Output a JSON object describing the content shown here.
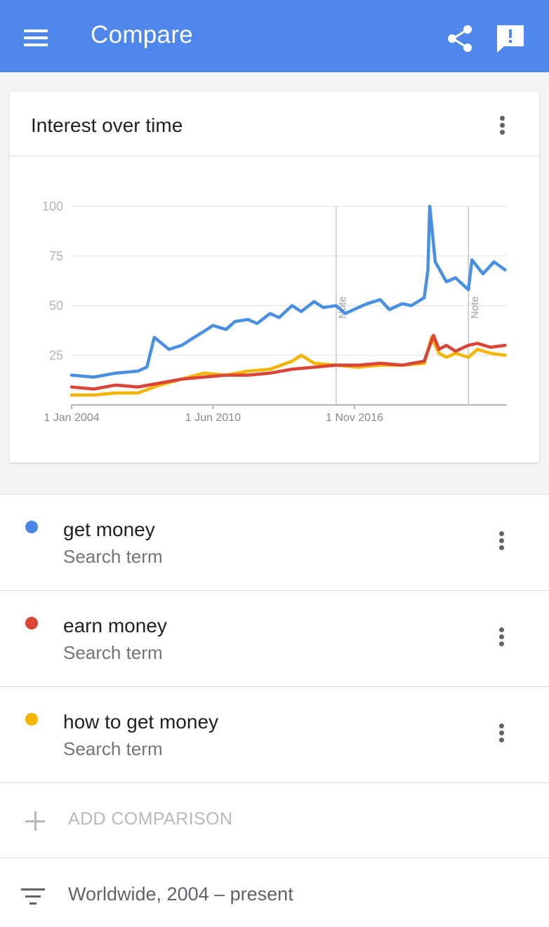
{
  "appbar": {
    "title": "Compare"
  },
  "card": {
    "title": "Interest over time"
  },
  "chart_data": {
    "type": "line",
    "y_ticks": [
      "100",
      "75",
      "50",
      "25"
    ],
    "ylim": [
      0,
      100
    ],
    "x_ticks": [
      "1 Jan 2004",
      "1 Jun 2010",
      "1 Nov 2016"
    ],
    "x_tick_dates": [
      "2004-01-01",
      "2010-06-01",
      "2016-11-01"
    ],
    "x_range": [
      "2004-01-01",
      "2023-10-01"
    ],
    "notes": [
      {
        "date": "2016-01-01",
        "label": "Note"
      },
      {
        "date": "2022-01-01",
        "label": "Note"
      }
    ],
    "grid": true,
    "series": [
      {
        "name": "get money",
        "color": "#4a90e2",
        "points": [
          [
            "2004-01-01",
            15
          ],
          [
            "2005-01-01",
            14
          ],
          [
            "2006-01-01",
            16
          ],
          [
            "2007-01-01",
            17
          ],
          [
            "2007-06-01",
            19
          ],
          [
            "2007-10-01",
            34
          ],
          [
            "2008-06-01",
            28
          ],
          [
            "2009-01-01",
            30
          ],
          [
            "2009-06-01",
            33
          ],
          [
            "2010-01-01",
            37
          ],
          [
            "2010-06-01",
            40
          ],
          [
            "2011-01-01",
            38
          ],
          [
            "2011-06-01",
            42
          ],
          [
            "2012-01-01",
            43
          ],
          [
            "2012-06-01",
            41
          ],
          [
            "2013-01-01",
            46
          ],
          [
            "2013-06-01",
            44
          ],
          [
            "2014-01-01",
            50
          ],
          [
            "2014-06-01",
            47
          ],
          [
            "2015-01-01",
            52
          ],
          [
            "2015-06-01",
            49
          ],
          [
            "2016-01-01",
            50
          ],
          [
            "2016-06-01",
            46
          ],
          [
            "2017-01-01",
            49
          ],
          [
            "2017-06-01",
            51
          ],
          [
            "2018-01-01",
            53
          ],
          [
            "2018-06-01",
            48
          ],
          [
            "2019-01-01",
            51
          ],
          [
            "2019-06-01",
            50
          ],
          [
            "2020-01-01",
            54
          ],
          [
            "2020-03-01",
            68
          ],
          [
            "2020-04-01",
            100
          ],
          [
            "2020-07-01",
            72
          ],
          [
            "2021-01-01",
            62
          ],
          [
            "2021-06-01",
            64
          ],
          [
            "2022-01-01",
            58
          ],
          [
            "2022-03-01",
            73
          ],
          [
            "2022-09-01",
            66
          ],
          [
            "2023-03-01",
            72
          ],
          [
            "2023-09-01",
            68
          ]
        ]
      },
      {
        "name": "earn money",
        "color": "#db4437",
        "points": [
          [
            "2004-01-01",
            9
          ],
          [
            "2005-01-01",
            8
          ],
          [
            "2006-01-01",
            10
          ],
          [
            "2007-01-01",
            9
          ],
          [
            "2008-01-01",
            11
          ],
          [
            "2009-01-01",
            13
          ],
          [
            "2010-01-01",
            14
          ],
          [
            "2011-01-01",
            15
          ],
          [
            "2012-01-01",
            15
          ],
          [
            "2013-01-01",
            16
          ],
          [
            "2014-01-01",
            18
          ],
          [
            "2015-01-01",
            19
          ],
          [
            "2016-01-01",
            20
          ],
          [
            "2017-01-01",
            20
          ],
          [
            "2018-01-01",
            21
          ],
          [
            "2019-01-01",
            20
          ],
          [
            "2020-01-01",
            22
          ],
          [
            "2020-06-01",
            35
          ],
          [
            "2020-09-01",
            28
          ],
          [
            "2021-01-01",
            30
          ],
          [
            "2021-06-01",
            27
          ],
          [
            "2022-01-01",
            30
          ],
          [
            "2022-06-01",
            31
          ],
          [
            "2023-01-01",
            29
          ],
          [
            "2023-09-01",
            30
          ]
        ]
      },
      {
        "name": "how to get money",
        "color": "#f4b400",
        "points": [
          [
            "2004-01-01",
            5
          ],
          [
            "2005-01-01",
            5
          ],
          [
            "2006-01-01",
            6
          ],
          [
            "2007-01-01",
            6
          ],
          [
            "2008-01-01",
            10
          ],
          [
            "2009-01-01",
            13
          ],
          [
            "2010-01-01",
            16
          ],
          [
            "2011-01-01",
            15
          ],
          [
            "2012-01-01",
            17
          ],
          [
            "2013-01-01",
            18
          ],
          [
            "2014-01-01",
            22
          ],
          [
            "2014-06-01",
            25
          ],
          [
            "2015-01-01",
            21
          ],
          [
            "2016-01-01",
            20
          ],
          [
            "2017-01-01",
            19
          ],
          [
            "2018-01-01",
            20
          ],
          [
            "2019-01-01",
            20
          ],
          [
            "2020-01-01",
            21
          ],
          [
            "2020-05-01",
            34
          ],
          [
            "2020-09-01",
            26
          ],
          [
            "2021-01-01",
            24
          ],
          [
            "2021-06-01",
            26
          ],
          [
            "2022-01-01",
            24
          ],
          [
            "2022-06-01",
            28
          ],
          [
            "2023-01-01",
            26
          ],
          [
            "2023-09-01",
            25
          ]
        ]
      }
    ]
  },
  "terms": [
    {
      "name": "get money",
      "subtitle": "Search term",
      "color": "#4a86e8"
    },
    {
      "name": "earn money",
      "subtitle": "Search term",
      "color": "#db4437"
    },
    {
      "name": "how to get money",
      "subtitle": "Search term",
      "color": "#f4b400"
    }
  ],
  "add_comparison": {
    "label": "ADD COMPARISON"
  },
  "filter": {
    "label": "Worldwide, 2004 – present"
  }
}
